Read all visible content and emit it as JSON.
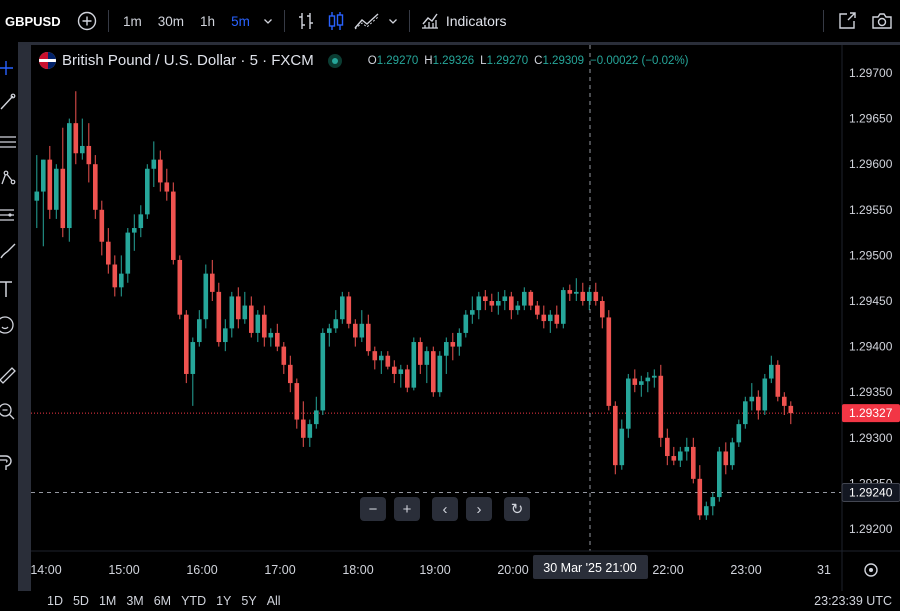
{
  "toolbar": {
    "symbol": "GBPUSD",
    "intervals": [
      "1m",
      "30m",
      "1h",
      "5m"
    ],
    "active_interval": "5m",
    "indicators_label": "Indicators",
    "icons": [
      "add-symbol-icon",
      "chevron-down-icon",
      "bar-style-icon",
      "candle-style-icon",
      "area-style-icon",
      "chevron-down-icon",
      "indicators-icon",
      "fullscreen-icon",
      "camera-icon"
    ]
  },
  "left_tools": [
    "crosshair-icon",
    "trend-line-icon",
    "fib-icon",
    "pattern-icon",
    "projection-icon",
    "brush-icon",
    "text-icon",
    "emoji-icon",
    "ruler-icon",
    "zoom-icon",
    "magnet-icon"
  ],
  "legend": {
    "title": "British Pound / U.S. Dollar · 5 · FXCM",
    "o_label": "O",
    "o_value": "1.29270",
    "h_label": "H",
    "h_value": "1.29326",
    "l_label": "L",
    "l_value": "1.29270",
    "c_label": "C",
    "c_value": "1.29309",
    "change": "−0.00022 (−0.02%)"
  },
  "price_badge": "1.29327",
  "crosshair_price_badge": "1.29240",
  "crosshair_time_badge": "30 Mar '25   21:00",
  "nav_controls": [
    "−",
    "+",
    "‹",
    "›",
    "↻"
  ],
  "bottom": {
    "ranges": [
      "1D",
      "5D",
      "1M",
      "3M",
      "6M",
      "YTD",
      "1Y",
      "5Y",
      "All"
    ],
    "clock": "23:23:39 UTC"
  },
  "colors": {
    "up": "#26a69a",
    "down": "#ef5350",
    "background": "#000000",
    "grid_text": "#d1d4dc",
    "current_price": "#f23645",
    "accent": "#2962ff"
  },
  "chart_data": {
    "type": "candlestick",
    "title": "British Pound / U.S. Dollar · 5 · FXCM",
    "x_ticks": [
      "14:00",
      "15:00",
      "16:00",
      "17:00",
      "18:00",
      "19:00",
      "20:00",
      "21:00",
      "22:00",
      "23:00",
      "31"
    ],
    "y_ticks": [
      "1.29700",
      "1.29650",
      "1.29600",
      "1.29550",
      "1.29500",
      "1.29450",
      "1.29400",
      "1.29350",
      "1.29300",
      "1.29250",
      "1.29200"
    ],
    "ylim": [
      1.2918,
      1.2971
    ],
    "current_price": 1.29327,
    "crosshair_price": 1.2924,
    "crosshair_time": "30 Mar '25 21:00",
    "candles": [
      [
        1.2956,
        1.2961,
        1.2953,
        1.2957
      ],
      [
        1.2957,
        1.29605,
        1.2951,
        1.29605
      ],
      [
        1.29605,
        1.2962,
        1.2954,
        1.2955
      ],
      [
        1.2955,
        1.296,
        1.2954,
        1.29595
      ],
      [
        1.29595,
        1.2964,
        1.2952,
        1.2953
      ],
      [
        1.2953,
        1.2965,
        1.29515,
        1.29645
      ],
      [
        1.29645,
        1.2968,
        1.296,
        1.29612
      ],
      [
        1.29612,
        1.2965,
        1.29605,
        1.2962
      ],
      [
        1.2962,
        1.29645,
        1.2958,
        1.296
      ],
      [
        1.296,
        1.2961,
        1.2954,
        1.2955
      ],
      [
        1.2955,
        1.2956,
        1.295,
        1.29515
      ],
      [
        1.29515,
        1.2953,
        1.2948,
        1.2949
      ],
      [
        1.2949,
        1.295,
        1.29455,
        1.29465
      ],
      [
        1.29465,
        1.295,
        1.29455,
        1.2948
      ],
      [
        1.2948,
        1.2953,
        1.2947,
        1.29525
      ],
      [
        1.29525,
        1.29545,
        1.29505,
        1.2953
      ],
      [
        1.2953,
        1.29555,
        1.2952,
        1.29545
      ],
      [
        1.29545,
        1.296,
        1.2954,
        1.29595
      ],
      [
        1.29595,
        1.29625,
        1.29575,
        1.29605
      ],
      [
        1.29605,
        1.29615,
        1.2957,
        1.2958
      ],
      [
        1.2958,
        1.29595,
        1.2956,
        1.2957
      ],
      [
        1.2957,
        1.2958,
        1.2949,
        1.29495
      ],
      [
        1.29495,
        1.295,
        1.2943,
        1.29435
      ],
      [
        1.29435,
        1.2944,
        1.2936,
        1.2937
      ],
      [
        1.2937,
        1.2941,
        1.29335,
        1.29405
      ],
      [
        1.29405,
        1.2944,
        1.294,
        1.2943
      ],
      [
        1.2943,
        1.2949,
        1.2942,
        1.2948
      ],
      [
        1.2948,
        1.29495,
        1.2945,
        1.2946
      ],
      [
        1.2946,
        1.2947,
        1.294,
        1.29405
      ],
      [
        1.29405,
        1.2943,
        1.29395,
        1.2942
      ],
      [
        1.2942,
        1.2946,
        1.2941,
        1.29455
      ],
      [
        1.29455,
        1.29465,
        1.2942,
        1.2943
      ],
      [
        1.2943,
        1.2946,
        1.29425,
        1.29445
      ],
      [
        1.29445,
        1.29455,
        1.2941,
        1.29415
      ],
      [
        1.29415,
        1.2944,
        1.29405,
        1.29435
      ],
      [
        1.29435,
        1.29445,
        1.294,
        1.2941
      ],
      [
        1.2941,
        1.2942,
        1.294,
        1.29415
      ],
      [
        1.29415,
        1.29425,
        1.29395,
        1.294
      ],
      [
        1.294,
        1.29405,
        1.2937,
        1.2938
      ],
      [
        1.2938,
        1.2939,
        1.2935,
        1.2936
      ],
      [
        1.2936,
        1.29365,
        1.2931,
        1.2932
      ],
      [
        1.2932,
        1.2934,
        1.2929,
        1.293
      ],
      [
        1.293,
        1.2932,
        1.2929,
        1.29315
      ],
      [
        1.29315,
        1.29345,
        1.2931,
        1.2933
      ],
      [
        1.2933,
        1.2942,
        1.29325,
        1.29415
      ],
      [
        1.29415,
        1.29425,
        1.294,
        1.2942
      ],
      [
        1.2942,
        1.2944,
        1.29415,
        1.2943
      ],
      [
        1.2943,
        1.2946,
        1.29425,
        1.29455
      ],
      [
        1.29455,
        1.2946,
        1.2942,
        1.29425
      ],
      [
        1.29425,
        1.2943,
        1.294,
        1.2941
      ],
      [
        1.2941,
        1.2944,
        1.29405,
        1.29425
      ],
      [
        1.29425,
        1.29435,
        1.2939,
        1.29395
      ],
      [
        1.29395,
        1.294,
        1.29375,
        1.29385
      ],
      [
        1.29385,
        1.29395,
        1.2937,
        1.2939
      ],
      [
        1.2939,
        1.29395,
        1.29375,
        1.29378
      ],
      [
        1.29378,
        1.29385,
        1.2936,
        1.2937
      ],
      [
        1.2937,
        1.2938,
        1.29355,
        1.29375
      ],
      [
        1.29375,
        1.2938,
        1.2935,
        1.29355
      ],
      [
        1.29355,
        1.2941,
        1.29352,
        1.29405
      ],
      [
        1.29405,
        1.2941,
        1.2937,
        1.2938
      ],
      [
        1.2938,
        1.294,
        1.2936,
        1.29395
      ],
      [
        1.29395,
        1.294,
        1.29345,
        1.2935
      ],
      [
        1.2935,
        1.29395,
        1.29345,
        1.2939
      ],
      [
        1.2939,
        1.2941,
        1.2937,
        1.29405
      ],
      [
        1.29405,
        1.29415,
        1.29385,
        1.294
      ],
      [
        1.294,
        1.2942,
        1.2939,
        1.29415
      ],
      [
        1.29415,
        1.2944,
        1.2941,
        1.29435
      ],
      [
        1.29435,
        1.29455,
        1.29425,
        1.2944
      ],
      [
        1.2944,
        1.2946,
        1.2943,
        1.29455
      ],
      [
        1.29455,
        1.29462,
        1.2944,
        1.2945
      ],
      [
        1.2945,
        1.29458,
        1.29438,
        1.29445
      ],
      [
        1.29445,
        1.2946,
        1.29435,
        1.2945
      ],
      [
        1.2945,
        1.29462,
        1.2944,
        1.29455
      ],
      [
        1.29455,
        1.2946,
        1.2943,
        1.2944
      ],
      [
        1.2944,
        1.2945,
        1.29435,
        1.29445
      ],
      [
        1.29445,
        1.29465,
        1.2944,
        1.2946
      ],
      [
        1.2946,
        1.29462,
        1.2944,
        1.29445
      ],
      [
        1.29445,
        1.2945,
        1.2943,
        1.29435
      ],
      [
        1.29435,
        1.29445,
        1.2942,
        1.29428
      ],
      [
        1.29428,
        1.2944,
        1.29415,
        1.29435
      ],
      [
        1.29435,
        1.29445,
        1.2942,
        1.29425
      ],
      [
        1.29425,
        1.29465,
        1.2942,
        1.29462
      ],
      [
        1.29462,
        1.29468,
        1.2945,
        1.29458
      ],
      [
        1.29458,
        1.29475,
        1.2945,
        1.2946
      ],
      [
        1.2946,
        1.2947,
        1.29445,
        1.2945
      ],
      [
        1.2945,
        1.29465,
        1.2944,
        1.2946
      ],
      [
        1.2946,
        1.2947,
        1.29445,
        1.2945
      ],
      [
        1.2945,
        1.29455,
        1.2942,
        1.29432
      ],
      [
        1.29432,
        1.2944,
        1.2933,
        1.29335
      ],
      [
        1.29335,
        1.2934,
        1.2926,
        1.2927
      ],
      [
        1.2927,
        1.2932,
        1.29265,
        1.2931
      ],
      [
        1.2931,
        1.2937,
        1.293,
        1.29365
      ],
      [
        1.29365,
        1.29375,
        1.2935,
        1.29358
      ],
      [
        1.29358,
        1.29368,
        1.29345,
        1.29362
      ],
      [
        1.29362,
        1.29372,
        1.2935,
        1.29366
      ],
      [
        1.29366,
        1.29375,
        1.29355,
        1.29368
      ],
      [
        1.29368,
        1.2938,
        1.2929,
        1.293
      ],
      [
        1.293,
        1.2931,
        1.2927,
        1.2928
      ],
      [
        1.2928,
        1.2929,
        1.2927,
        1.29275
      ],
      [
        1.29275,
        1.2929,
        1.29268,
        1.29285
      ],
      [
        1.29285,
        1.293,
        1.29275,
        1.2929
      ],
      [
        1.2929,
        1.293,
        1.2925,
        1.29255
      ],
      [
        1.29255,
        1.2927,
        1.2921,
        1.29215
      ],
      [
        1.29215,
        1.2923,
        1.2921,
        1.29225
      ],
      [
        1.29225,
        1.2924,
        1.29215,
        1.29235
      ],
      [
        1.29235,
        1.2929,
        1.2923,
        1.29285
      ],
      [
        1.29285,
        1.29295,
        1.2926,
        1.2927
      ],
      [
        1.2927,
        1.293,
        1.29265,
        1.29295
      ],
      [
        1.29295,
        1.2932,
        1.2929,
        1.29315
      ],
      [
        1.29315,
        1.29345,
        1.2931,
        1.2934
      ],
      [
        1.2934,
        1.2936,
        1.2933,
        1.29345
      ],
      [
        1.29345,
        1.29352,
        1.2932,
        1.2933
      ],
      [
        1.2933,
        1.2937,
        1.29325,
        1.29365
      ],
      [
        1.29365,
        1.2939,
        1.2936,
        1.2938
      ],
      [
        1.2938,
        1.29385,
        1.2934,
        1.29345
      ],
      [
        1.29345,
        1.2935,
        1.29325,
        1.29335
      ],
      [
        1.29335,
        1.2934,
        1.29315,
        1.29327
      ]
    ]
  }
}
